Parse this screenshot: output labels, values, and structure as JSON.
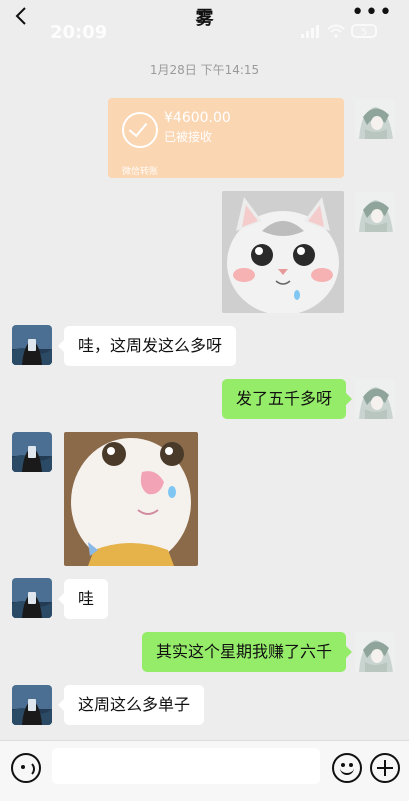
{
  "header": {
    "title": "雾",
    "back_icon": "chevron-left-icon",
    "more_label": "•••",
    "status_time": "20:09",
    "battery": "5"
  },
  "timestamp": "1月28日 下午14:15",
  "transfer": {
    "amount": "¥4600.00",
    "status": "已被接收",
    "footer": "微信转账"
  },
  "messages": {
    "m1": "哇，这周发这么多呀",
    "m2": "发了五千多呀",
    "m3": "哇",
    "m4": "其实这个星期我赚了六千",
    "m5": "这周这么多单子"
  },
  "stickers": {
    "s1": "cat-sticker",
    "s2": "cat-sticker"
  },
  "input_bar": {
    "voice_icon": "voice-icon",
    "emoji_icon": "emoji-icon",
    "plus_icon": "plus-icon"
  },
  "colors": {
    "background": "#ededed",
    "sent_bubble": "#95ec69",
    "received_bubble": "#ffffff",
    "transfer_card": "#fbd6b3"
  }
}
